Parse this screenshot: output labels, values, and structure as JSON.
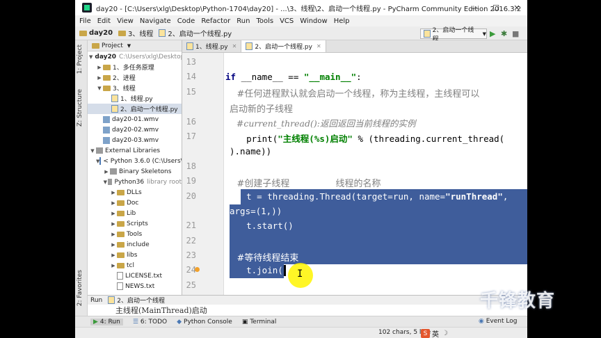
{
  "window": {
    "title": "day20 - [C:\\Users\\xlg\\Desktop\\Python-1704\\day20] - ...\\3、线程\\2、启动一个线程.py - PyCharm Community Edition 2016.3.2",
    "buttons": {
      "minimize": "—",
      "maximize": "☐",
      "close": "✕"
    }
  },
  "menu": [
    "File",
    "Edit",
    "View",
    "Navigate",
    "Code",
    "Refactor",
    "Run",
    "Tools",
    "VCS",
    "Window",
    "Help"
  ],
  "breadcrumb": [
    "day20",
    "3、线程",
    "2、启动一个线程.py"
  ],
  "run_config": "2、启动一个线程",
  "side_labels": {
    "project": "1: Project",
    "structure": "Z: Structure",
    "favorites": "2: Favorites"
  },
  "project": {
    "header": "Project",
    "root_name": "day20",
    "root_path": "C:\\Users\\xlg\\Desktop",
    "items": [
      {
        "label": "1、多任务原理"
      },
      {
        "label": "2、进程"
      },
      {
        "label": "3、线程"
      },
      {
        "label": "1、线程.py"
      },
      {
        "label": "2、启动一个线程.py"
      },
      {
        "label": "day20-01.wmv"
      },
      {
        "label": "day20-02.wmv"
      },
      {
        "label": "day20-03.wmv"
      },
      {
        "label": "External Libraries"
      },
      {
        "label": "< Python 3.6.0 (C:\\Users\\"
      },
      {
        "label": "Binary Skeletons"
      },
      {
        "label": "Python36",
        "note": "library root"
      },
      {
        "label": "DLLs"
      },
      {
        "label": "Doc"
      },
      {
        "label": "Lib"
      },
      {
        "label": "Scripts"
      },
      {
        "label": "Tools"
      },
      {
        "label": "include"
      },
      {
        "label": "libs"
      },
      {
        "label": "tcl"
      },
      {
        "label": "LICENSE.txt"
      },
      {
        "label": "NEWS.txt"
      }
    ]
  },
  "tabs": [
    "1、线程.py",
    "2、启动一个线程.py"
  ],
  "editor": {
    "line_numbers": [
      "13",
      "14",
      "15",
      "16",
      "17",
      "18",
      "19",
      "20",
      "21",
      "22",
      "23",
      "24",
      "25"
    ],
    "code": {
      "l14_a": "if ",
      "l14_b": "__name__ == ",
      "l14_c": "\"__main__\"",
      "l14_d": ":",
      "l15a": "    #任何进程默认就会启动一个线程，称为主线程，主线程可以",
      "l15b": "启动新的子线程",
      "l16": "    #current_thread():返回返回当前线程的实例",
      "l17_a": "    print(",
      "l17_b": "\"主线程(%s)启动\"",
      "l17_c": " % (threading.current_thread(",
      "l17d": ").name))",
      "l19_a": "    #创建子线程",
      "l19_b": "                线程的名称",
      "l20_a": "    t = threading.Thread(target=run, name=",
      "l20_b": "\"runThread\"",
      "l20_c": ",",
      "l20d": "args=(1,))",
      "l21": "    t.start()",
      "l23": "    #等待线程结束",
      "l24": "    t.join()"
    }
  },
  "run_panel": {
    "title": "Run",
    "config": "2、启动一个线程",
    "output": "主线程(MainThread)启动"
  },
  "bottom_tabs": [
    {
      "icon": "▶",
      "label": "4: Run"
    },
    {
      "icon": "6",
      "label": "6: TODO"
    },
    {
      "icon": "◆",
      "label": "Python Console"
    },
    {
      "icon": "▣",
      "label": "Terminal"
    }
  ],
  "event_log": "Event Log",
  "status": {
    "info": "102 chars, 5 line",
    "ime": "英"
  },
  "watermark": "千锋教育"
}
